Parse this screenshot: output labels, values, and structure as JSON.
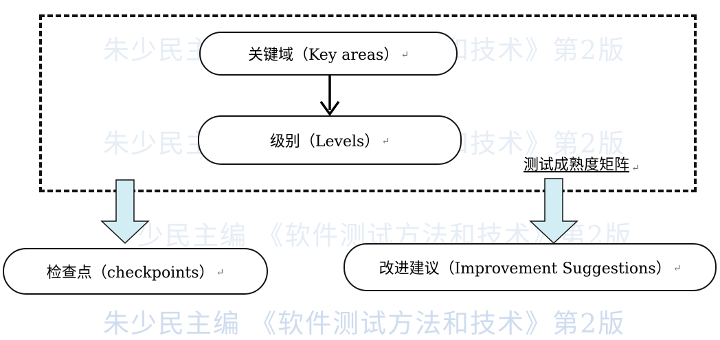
{
  "watermark": {
    "line1": "朱少民主编 《软件测试方法和技术》第2版",
    "line2": "朱少民主编 《软件测试方法和技术》第2版",
    "line3": "少民主编 《软件测试方法和技术》第2版",
    "line4": "朱少民主编 《软件测试方法和技术》第2版"
  },
  "nodes": {
    "key_areas": "关键域（Key areas）",
    "levels": "级别（Levels）",
    "checkpoints": "检查点（checkpoints）",
    "improvement": "改进建议（Improvement Suggestions）"
  },
  "matrix_label": "测试成熟度矩阵",
  "paragraph_mark": "↵",
  "colors": {
    "arrow_fill": "#d2eef4",
    "watermark": "#e6edf6",
    "border": "#111111"
  }
}
